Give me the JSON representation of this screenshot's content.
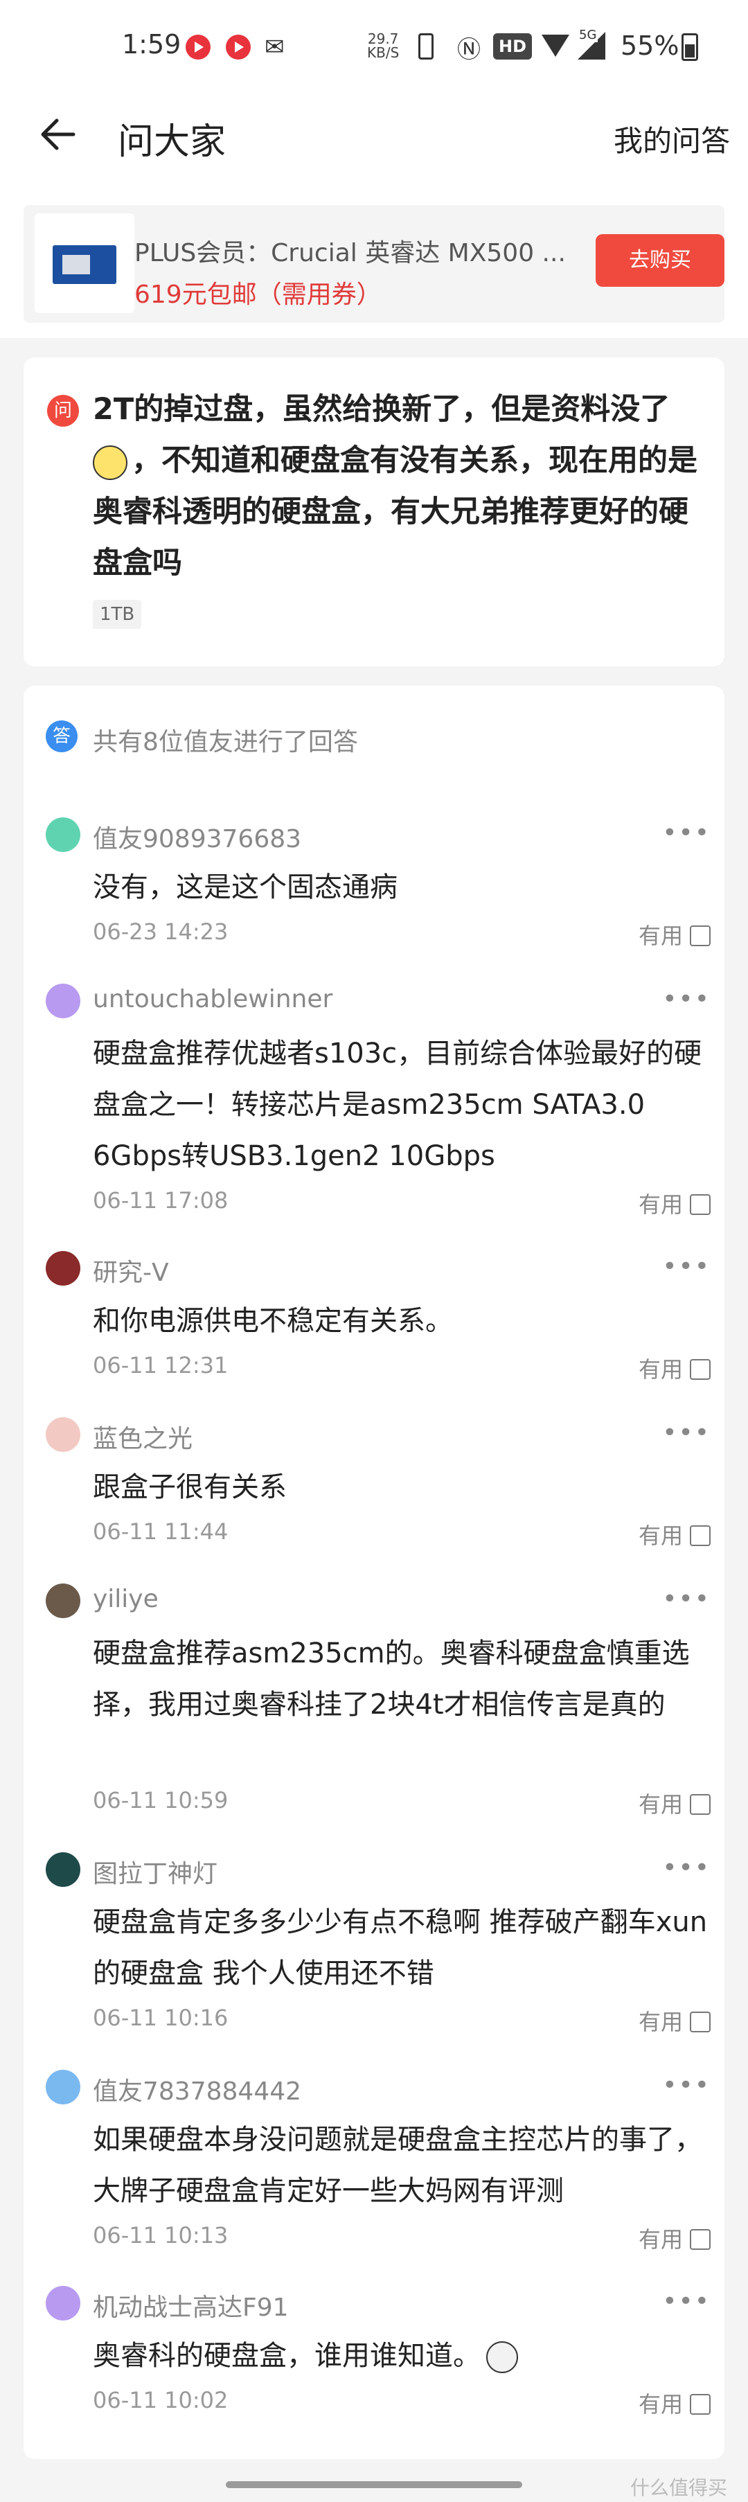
{
  "status_bar": {
    "time": "1:59",
    "net_speed_value": "29.7",
    "net_speed_unit": "KB/S",
    "hd_badge": "HD",
    "network_type": "5G",
    "battery": "55%"
  },
  "header": {
    "title": "问大家",
    "my_questions": "我的问答"
  },
  "product": {
    "name": "PLUS会员：Crucial 英睿达 MX500 ...",
    "price": "619元包邮（需用券）",
    "buy_label": "去购买"
  },
  "question": {
    "badge": "问",
    "text_before_emoji": "2T的掉过盘，虽然给换新了，但是资料没了",
    "text_after_emoji": "，不知道和硬盘盒有没有关系，现在用的是奥睿科透明的硬盘盒，有大兄弟推荐更好的硬盘盒吗",
    "tag": "1TB"
  },
  "answers_header": {
    "badge": "答",
    "summary": "共有8位值友进行了回答"
  },
  "answers": [
    {
      "user": "值友9089376683",
      "text": "没有，这是这个固态通病",
      "time": "06-23 14:23",
      "useful": "有用",
      "avatar_color": "#5fd3b0"
    },
    {
      "user": "untouchablewinner",
      "text": "硬盘盒推荐优越者s103c，目前综合体验最好的硬盘盒之一！转接芯片是asm235cm SATA3.0 6Gbps转USB3.1gen2 10Gbps",
      "time": "06-11 17:08",
      "useful": "有用",
      "avatar_color": "#b89af0"
    },
    {
      "user": "研究-V",
      "text": "和你电源供电不稳定有关系。",
      "time": "06-11 12:31",
      "useful": "有用",
      "avatar_color": "#8a2a2a"
    },
    {
      "user": "蓝色之光",
      "text": "跟盒子很有关系",
      "time": "06-11 11:44",
      "useful": "有用",
      "avatar_color": "#f3c9c3"
    },
    {
      "user": "yiliye",
      "text": "硬盘盒推荐asm235cm的。奥睿科硬盘盒慎重选择，我用过奥睿科挂了2块4t才相信传言是真的",
      "time": "06-11 10:59",
      "useful": "有用",
      "avatar_color": "#6b5a4a"
    },
    {
      "user": "图拉丁神灯",
      "text": "硬盘盒肯定多多少少有点不稳啊 推荐破产翻车xun的硬盘盒 我个人使用还不错",
      "time": "06-11 10:16",
      "useful": "有用",
      "avatar_color": "#1f4a4a"
    },
    {
      "user": "值友7837884442",
      "text": "如果硬盘本身没问题就是硬盘盒主控芯片的事了，大牌子硬盘盒肯定好一些大妈网有评测",
      "time": "06-11 10:13",
      "useful": "有用",
      "avatar_color": "#7ab8f0"
    },
    {
      "user": "机动战士高达F91",
      "text": "奥睿科的硬盘盒，谁用谁知道。",
      "time": "06-11 10:02",
      "useful": "有用",
      "avatar_color": "#b89af0"
    }
  ],
  "watermark": "什么值得买"
}
